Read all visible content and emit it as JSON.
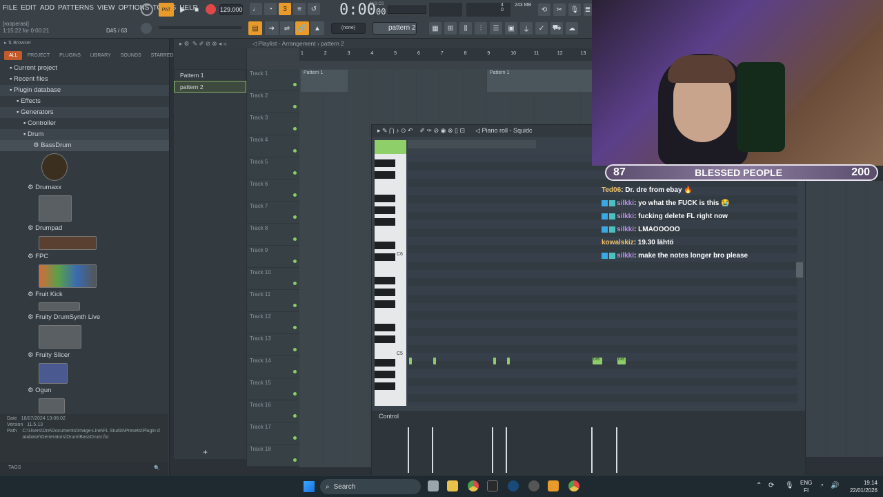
{
  "app": {
    "menu": [
      "FILE",
      "EDIT",
      "ADD",
      "PATTERNS",
      "VIEW",
      "OPTIONS",
      "TOOLS",
      "HELP"
    ],
    "hint_line1": "[rooperasi]",
    "hint_line2": "1:15:22 for 0:00:21",
    "hint_right": "D#5 / 63",
    "tempo": "129.000",
    "time": "0:00",
    "time_small": "00",
    "time_unit": "M:S:CS",
    "cpu_mem": "243 MB",
    "cpu_num": "4",
    "cpu_num2": "0",
    "pattern_select": "pattern 2",
    "none_select": "(none)",
    "browser_label": "Browser",
    "playlist_title": "Playlist - Arrangement",
    "playlist_pattern": "pattern 2",
    "piano_title": "Piano roll - Squidc",
    "control_label": "Control",
    "tags_label": "TAGS",
    "add_symbol": "+"
  },
  "browser": {
    "tabs": [
      "ALL",
      "PROJECT",
      "PLUGINS",
      "LIBRARY",
      "SOUNDS",
      "STARRED"
    ],
    "tree": [
      {
        "label": "Current project",
        "indent": 14
      },
      {
        "label": "Recent files",
        "indent": 14
      },
      {
        "label": "Plugin database",
        "indent": 14
      },
      {
        "label": "Effects",
        "indent": 24
      },
      {
        "label": "Generators",
        "indent": 24
      },
      {
        "label": "Controller",
        "indent": 34
      },
      {
        "label": "Drum",
        "indent": 34
      },
      {
        "label": "BassDrum",
        "indent": 48
      }
    ],
    "plugins": [
      "Drumaxx",
      "Drumpad",
      "FPC",
      "Fruit Kick",
      "Fruity DrumSynth Live",
      "Fruity Slicer",
      "Ogun"
    ],
    "info": {
      "date_label": "Date",
      "date": "18/07/2024 13:06:02",
      "version_label": "Version",
      "version": "11.5.13",
      "path_label": "Path",
      "path": "C:\\Users\\Dre\\Documents\\Image-Line\\FL Studio\\Presets\\Plugin database\\Generators\\Drum\\BassDrum.fst"
    }
  },
  "patterns": [
    "Pattern 1",
    "pattern 2"
  ],
  "playlist": {
    "ruler": [
      "1",
      "2",
      "3",
      "4",
      "5",
      "6",
      "7",
      "8",
      "9",
      "10",
      "11",
      "12",
      "13"
    ],
    "clips": [
      "Pattern 1",
      "Pattern 1"
    ],
    "tracks": [
      "Track 1",
      "Track 2",
      "Track 3",
      "Track 4",
      "Track 5",
      "Track 6",
      "Track 7",
      "Track 8",
      "Track 9",
      "Track 10",
      "Track 11",
      "Track 12",
      "Track 13",
      "Track 14",
      "Track 15",
      "Track 16",
      "Track 17",
      "Track 18"
    ]
  },
  "piano": {
    "c6": "C6",
    "c5": "C5",
    "note_labels": [
      "D#5",
      "D#5"
    ],
    "velocity_ratios": [
      1,
      1,
      1,
      1,
      1,
      1
    ]
  },
  "chat": {
    "banner_left": "87",
    "banner_title": "BLESSED PEOPLE",
    "banner_right": "200",
    "messages": [
      {
        "user": "Ted06",
        "text": ": Dr. dre from ebay 🔥",
        "badge": false,
        "color": "gold"
      },
      {
        "user": "silkki",
        "text": ": yo what the FUCK is this 😭",
        "badge": true,
        "color": "purple"
      },
      {
        "user": "silkki",
        "text": ": fucking delete FL right now",
        "badge": true,
        "color": "purple"
      },
      {
        "user": "silkki",
        "text": ": LMAOOOOO",
        "badge": true,
        "color": "purple"
      },
      {
        "user": "kowalskiz",
        "text": ": 19.30 lähtö",
        "badge": false,
        "color": "gold"
      },
      {
        "user": "silkki",
        "text": ": make the notes longer bro please",
        "badge": true,
        "color": "purple"
      }
    ]
  },
  "taskbar": {
    "search": "Search",
    "lang1": "ENG",
    "lang2": "FI",
    "time": "19.14",
    "date": "22/01/2026"
  }
}
